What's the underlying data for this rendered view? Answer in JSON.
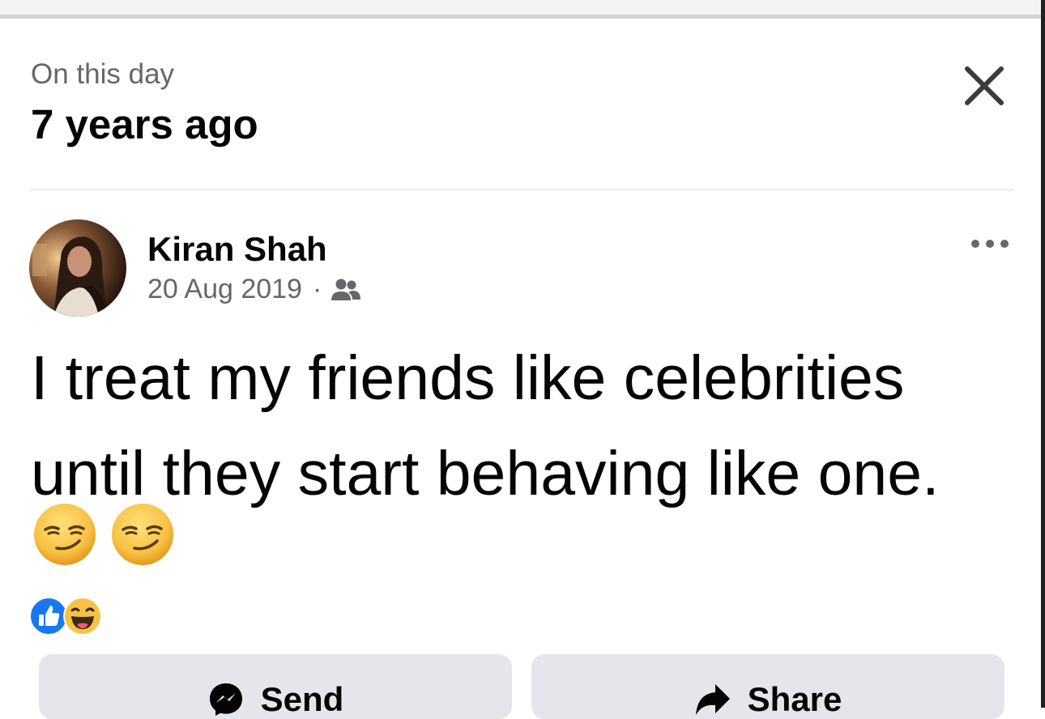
{
  "memory": {
    "subtitle": "On this day",
    "headline": "7 years ago"
  },
  "post": {
    "author": "Kiran Shah",
    "date": "20 Aug 2019",
    "separator": "·",
    "audience": "friends-icon",
    "text_line1": "I treat my friends like celebrities",
    "text_line2": "until they start behaving like one.",
    "emoji": [
      "smirking-face",
      "smirking-face"
    ],
    "reactions": [
      "like",
      "haha"
    ]
  },
  "actions": {
    "send_label": "Send",
    "share_label": "Share"
  },
  "colors": {
    "primary_text": "#050505",
    "secondary_text": "#65676b",
    "button_bg": "#e4e6eb",
    "like_blue": "#1877f2",
    "emoji_yellow": "#f7c245"
  }
}
